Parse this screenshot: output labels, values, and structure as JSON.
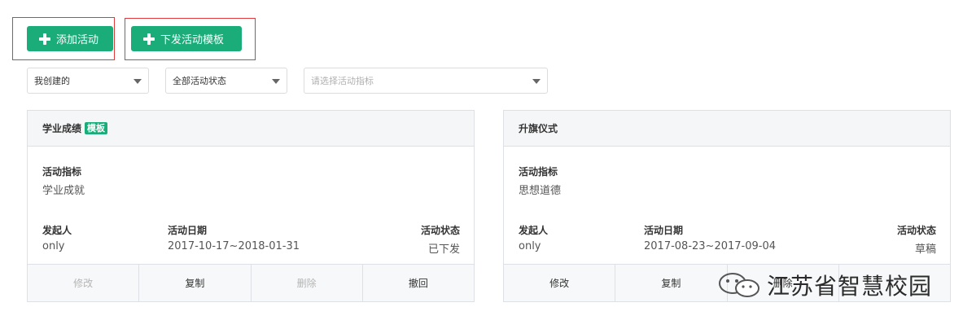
{
  "toolbar": {
    "add_activity": "添加活动",
    "issue_template": "下发活动模板"
  },
  "filters": {
    "creator": "我创建的",
    "status": "全部活动状态",
    "indicator_placeholder": "请选择活动指标"
  },
  "cards": [
    {
      "title": "学业成绩",
      "tag": "模板",
      "indicator_label": "活动指标",
      "indicator": "学业成就",
      "initiator_label": "发起人",
      "initiator": "only",
      "date_label": "活动日期",
      "date": "2017-10-17~2018-01-31",
      "status_label": "活动状态",
      "status": "已下发",
      "actions": [
        "修改",
        "复制",
        "删除",
        "撤回"
      ]
    },
    {
      "title": "升旗仪式",
      "indicator_label": "活动指标",
      "indicator": "思想道德",
      "initiator_label": "发起人",
      "initiator": "only",
      "date_label": "活动日期",
      "date": "2017-08-23~2017-09-04",
      "status_label": "活动状态",
      "status": "草稿",
      "actions": [
        "修改",
        "复制",
        "删除"
      ]
    }
  ],
  "watermark": "江苏省智慧校园",
  "colors": {
    "accent": "#1aad7a",
    "highlight_box": "#e23a3a"
  }
}
